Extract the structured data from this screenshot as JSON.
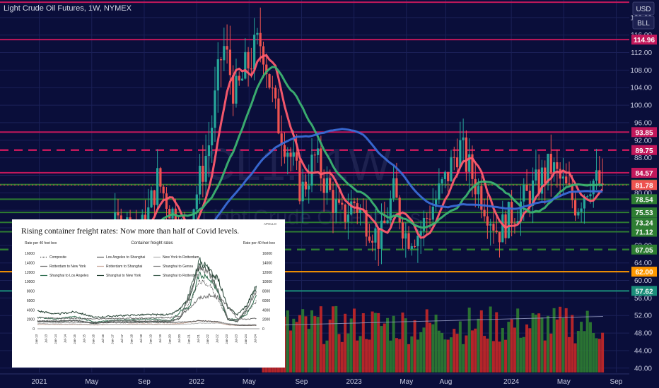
{
  "header": {
    "symbol_title": "Light Crude Oil Futures, 1W, NYMEX",
    "currency_button": "USD",
    "unit_button": "BLL",
    "watermark_big": "CL1!, 1W",
    "watermark_small": "Light Crude Oil Futures"
  },
  "colors": {
    "background": "#0a0e3a",
    "bull": "#26a69a",
    "bear": "#ef5350",
    "ma_fast": "#ff5b6e",
    "ma_mid": "#3cb371",
    "ma_slow": "#3a6bd6",
    "level_magenta": "#c2185b",
    "level_orange": "#ff9800",
    "level_teal": "#1b8e7a",
    "level_green": "#2e7d32",
    "volume_red": "#c62828",
    "volume_green": "#2e7d32"
  },
  "chart_data": [
    {
      "type": "candlestick",
      "title": "Light Crude Oil Futures, 1W, NYMEX",
      "x_ticks": [
        "2021",
        "May",
        "Sep",
        "2022",
        "May",
        "Sep",
        "2023",
        "May",
        "Aug",
        "2024",
        "May",
        "Sep"
      ],
      "y_ticks": [
        40.0,
        44.0,
        48.0,
        52.0,
        56.0,
        60.0,
        64.0,
        68.0,
        72.0,
        76.0,
        80.0,
        84.0,
        88.0,
        92.0,
        96.0,
        100.0,
        104.0,
        108.0,
        112.0,
        116.0,
        120.0
      ],
      "ylim": [
        39,
        124
      ],
      "horizontal_levels": [
        {
          "value": 123.5,
          "label": "",
          "style": "solid",
          "color": "magenta"
        },
        {
          "value": 114.96,
          "label": "114.96",
          "style": "solid",
          "color": "magenta"
        },
        {
          "value": 93.85,
          "label": "93.85",
          "style": "solid",
          "color": "magenta"
        },
        {
          "value": 89.75,
          "label": "89.75",
          "style": "dashed",
          "color": "magenta"
        },
        {
          "value": 84.57,
          "label": "84.57",
          "style": "solid",
          "color": "magenta"
        },
        {
          "value": 81.89,
          "label": "81.89",
          "style": "solid",
          "color": "green"
        },
        {
          "value": 78.54,
          "label": "78.54",
          "style": "solid",
          "color": "green"
        },
        {
          "value": 75.53,
          "label": "75.53",
          "style": "solid",
          "color": "green"
        },
        {
          "value": 73.24,
          "label": "73.24",
          "style": "solid",
          "color": "green"
        },
        {
          "value": 71.12,
          "label": "71.12",
          "style": "solid",
          "color": "green"
        },
        {
          "value": 67.05,
          "label": "67.05",
          "style": "dashed",
          "color": "green"
        },
        {
          "value": 62.0,
          "label": "62.00",
          "style": "solid",
          "color": "orange"
        },
        {
          "value": 57.62,
          "label": "57.62",
          "style": "solid",
          "color": "teal"
        }
      ],
      "last_price": {
        "value": 81.78,
        "label": "81.78"
      },
      "price_path": [
        {
          "x": "2021-01",
          "y": 52
        },
        {
          "x": "2021-03",
          "y": 62
        },
        {
          "x": "2021-05",
          "y": 65
        },
        {
          "x": "2021-07",
          "y": 73
        },
        {
          "x": "2021-09",
          "y": 72
        },
        {
          "x": "2021-10",
          "y": 83
        },
        {
          "x": "2021-12",
          "y": 70
        },
        {
          "x": "2022-01",
          "y": 80
        },
        {
          "x": "2022-02",
          "y": 92
        },
        {
          "x": "2022-03",
          "y": 114
        },
        {
          "x": "2022-04",
          "y": 102
        },
        {
          "x": "2022-05",
          "y": 110
        },
        {
          "x": "2022-06",
          "y": 115
        },
        {
          "x": "2022-07",
          "y": 98
        },
        {
          "x": "2022-08",
          "y": 90
        },
        {
          "x": "2022-09",
          "y": 80
        },
        {
          "x": "2022-10",
          "y": 88
        },
        {
          "x": "2022-12",
          "y": 74
        },
        {
          "x": "2023-01",
          "y": 78
        },
        {
          "x": "2023-03",
          "y": 69
        },
        {
          "x": "2023-04",
          "y": 80
        },
        {
          "x": "2023-05",
          "y": 70
        },
        {
          "x": "2023-06",
          "y": 71
        },
        {
          "x": "2023-08",
          "y": 83
        },
        {
          "x": "2023-09",
          "y": 91
        },
        {
          "x": "2023-10",
          "y": 84
        },
        {
          "x": "2023-12",
          "y": 71
        },
        {
          "x": "2024-01",
          "y": 75
        },
        {
          "x": "2024-03",
          "y": 82
        },
        {
          "x": "2024-04",
          "y": 86
        },
        {
          "x": "2024-06",
          "y": 77
        },
        {
          "x": "2024-07",
          "y": 83
        },
        {
          "x": "2024-08",
          "y": 81.78
        }
      ]
    },
    {
      "type": "line",
      "title": "Container freight rates",
      "heading": "Rising container freight rates: Now more than half of Covid levels.",
      "source_tag": "APOLLO",
      "ylabel_left": "Rate per 40 foot box",
      "ylabel_right": "Rate per 40 foot box",
      "ylim": [
        0,
        16000
      ],
      "y_ticks": [
        0,
        2000,
        4000,
        6000,
        8000,
        10000,
        12000,
        14000,
        16000
      ],
      "x_ticks": [
        "Jan-13",
        "Jul-13",
        "Jan-14",
        "Jul-14",
        "Jan-15",
        "Jul-15",
        "Jan-16",
        "Jul-16",
        "Jan-17",
        "Jul-17",
        "Jan-18",
        "Jul-18",
        "Jan-19",
        "Jul-19",
        "Jan-20",
        "Jul-20",
        "Jan-21",
        "Jul-21",
        "Jan-22",
        "Jul-22",
        "Jan-23",
        "Jul-23",
        "Jan-24",
        "Jul-24"
      ],
      "legend": [
        {
          "name": "Composite",
          "style": "dotted",
          "color": "#444444"
        },
        {
          "name": "Los Angeles to Shanghai",
          "style": "solid",
          "color": "#555555"
        },
        {
          "name": "New York to Rotterdam",
          "style": "solid",
          "color": "#b0b0b0"
        },
        {
          "name": "Rotterdam to New York",
          "style": "solid",
          "color": "#6e6e6e"
        },
        {
          "name": "Rotterdam to Shanghai",
          "style": "solid",
          "color": "#c8a89a"
        },
        {
          "name": "Shanghai to Genoa",
          "style": "solid",
          "color": "#7a7a7a"
        },
        {
          "name": "Shanghai to Los Angeles",
          "style": "solid",
          "color": "#2f6e4f"
        },
        {
          "name": "Shanghai to New York",
          "style": "solid",
          "color": "#1f3d2e"
        },
        {
          "name": "Shanghai to Rotterdam",
          "style": "solid",
          "color": "#3f5f50"
        }
      ],
      "series": [
        {
          "name": "Shanghai to Rotterdam",
          "x": [
            "Jan-13",
            "Jan-14",
            "Jan-15",
            "Jan-16",
            "Jan-17",
            "Jan-18",
            "Jan-19",
            "Jan-20",
            "Jul-20",
            "Jan-21",
            "Jul-21",
            "Jan-22",
            "Jul-22",
            "Jan-23",
            "Jul-23",
            "Jan-24",
            "Jul-24"
          ],
          "values": [
            1500,
            1600,
            1800,
            1100,
            1700,
            1600,
            1500,
            1600,
            2200,
            8000,
            14500,
            13000,
            7500,
            1900,
            1500,
            4000,
            8800
          ]
        },
        {
          "name": "Shanghai to New York",
          "x": [
            "Jan-13",
            "Jan-14",
            "Jan-15",
            "Jan-16",
            "Jan-17",
            "Jan-18",
            "Jan-19",
            "Jan-20",
            "Jul-20",
            "Jan-21",
            "Jul-21",
            "Jan-22",
            "Jul-22",
            "Jan-23",
            "Jul-23",
            "Jan-24",
            "Jul-24"
          ],
          "values": [
            3800,
            3100,
            3600,
            2400,
            2700,
            2900,
            3000,
            3000,
            4200,
            6500,
            13500,
            12500,
            10500,
            4500,
            3000,
            5000,
            9300
          ]
        },
        {
          "name": "Shanghai to Los Angeles",
          "x": [
            "Jan-13",
            "Jan-14",
            "Jan-15",
            "Jan-16",
            "Jan-17",
            "Jan-18",
            "Jan-19",
            "Jan-20",
            "Jul-20",
            "Jan-21",
            "Jul-21",
            "Jan-22",
            "Jul-22",
            "Jan-23",
            "Jul-23",
            "Jan-24",
            "Jul-24"
          ],
          "values": [
            2400,
            2100,
            2600,
            1400,
            1800,
            1900,
            2100,
            1700,
            3600,
            4700,
            11500,
            10800,
            7800,
            2100,
            1900,
            3100,
            7100
          ]
        },
        {
          "name": "Shanghai to Genoa",
          "x": [
            "Jan-13",
            "Jan-14",
            "Jan-15",
            "Jan-16",
            "Jan-17",
            "Jan-18",
            "Jan-19",
            "Jan-20",
            "Jul-20",
            "Jan-21",
            "Jul-21",
            "Jan-22",
            "Jul-22",
            "Jan-23",
            "Jul-23",
            "Jan-24",
            "Jul-24"
          ],
          "values": [
            1600,
            1700,
            1800,
            1200,
            1700,
            1700,
            1600,
            1700,
            2300,
            7200,
            13000,
            12000,
            8000,
            2200,
            1700,
            4300,
            7800
          ]
        },
        {
          "name": "Composite",
          "x": [
            "Jan-13",
            "Jan-14",
            "Jan-15",
            "Jan-16",
            "Jan-17",
            "Jan-18",
            "Jan-19",
            "Jan-20",
            "Jul-20",
            "Jan-21",
            "Jul-21",
            "Jan-22",
            "Jul-22",
            "Jan-23",
            "Jul-23",
            "Jan-24",
            "Jul-24"
          ],
          "values": [
            1700,
            1600,
            1700,
            1100,
            1500,
            1500,
            1500,
            1500,
            2200,
            5500,
            10000,
            9500,
            6000,
            2100,
            1500,
            3500,
            5800
          ]
        },
        {
          "name": "Rotterdam to Shanghai",
          "x": [
            "Jan-13",
            "Jan-14",
            "Jan-15",
            "Jan-16",
            "Jan-17",
            "Jan-18",
            "Jan-19",
            "Jan-20",
            "Jul-20",
            "Jan-21",
            "Jul-21",
            "Jan-22",
            "Jul-22",
            "Jan-23",
            "Jul-23",
            "Jan-24",
            "Jul-24"
          ],
          "values": [
            900,
            900,
            900,
            800,
            900,
            1000,
            1000,
            1000,
            1100,
            1400,
            1700,
            1600,
            1300,
            800,
            700,
            700,
            700
          ]
        },
        {
          "name": "Los Angeles to Shanghai",
          "x": [
            "Jan-13",
            "Jan-14",
            "Jan-15",
            "Jan-16",
            "Jan-17",
            "Jan-18",
            "Jan-19",
            "Jan-20",
            "Jul-20",
            "Jan-21",
            "Jul-21",
            "Jan-22",
            "Jul-22",
            "Jan-23",
            "Jul-23",
            "Jan-24",
            "Jul-24"
          ],
          "values": [
            1500,
            1400,
            1400,
            1300,
            1300,
            1300,
            1400,
            1300,
            1400,
            1500,
            1700,
            1600,
            1500,
            1000,
            750,
            700,
            750
          ]
        },
        {
          "name": "New York to Rotterdam",
          "x": [
            "Jan-13",
            "Jan-14",
            "Jan-15",
            "Jan-16",
            "Jan-17",
            "Jan-18",
            "Jan-19",
            "Jan-20",
            "Jul-20",
            "Jan-21",
            "Jul-21",
            "Jan-22",
            "Jul-22",
            "Jan-23",
            "Jul-23",
            "Jan-24",
            "Jul-24"
          ],
          "values": [
            1100,
            1000,
            1000,
            900,
            900,
            900,
            900,
            900,
            900,
            1000,
            1200,
            1200,
            1200,
            1100,
            900,
            900,
            900
          ]
        },
        {
          "name": "Rotterdam to New York",
          "x": [
            "Jan-13",
            "Jan-14",
            "Jan-15",
            "Jan-16",
            "Jan-17",
            "Jan-18",
            "Jan-19",
            "Jan-20",
            "Jul-20",
            "Jan-21",
            "Jul-21",
            "Jan-22",
            "Jul-22",
            "Jan-23",
            "Jul-23",
            "Jan-24",
            "Jul-24"
          ],
          "values": [
            2300,
            2200,
            2200,
            2100,
            2200,
            2200,
            2300,
            2400,
            2600,
            4500,
            6500,
            7000,
            6700,
            4800,
            2100,
            2000,
            2200
          ]
        }
      ]
    }
  ]
}
